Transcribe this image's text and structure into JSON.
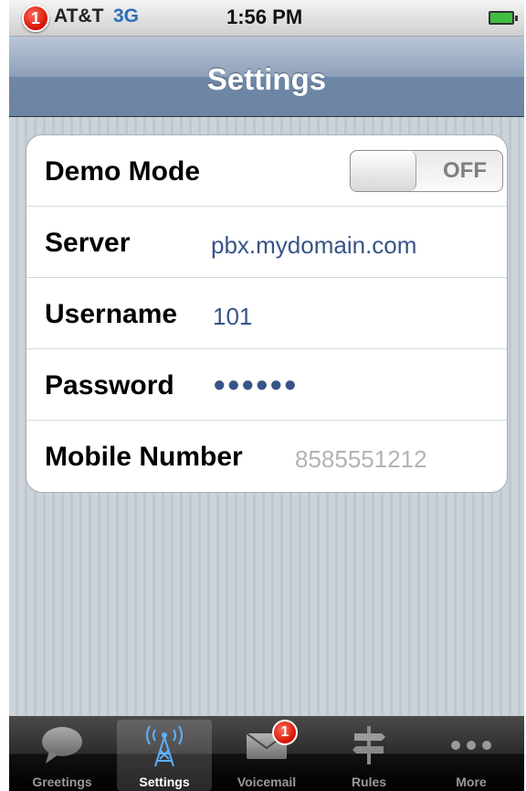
{
  "status_bar": {
    "badge_count": "1",
    "carrier": "AT&T",
    "network": "3G",
    "time": "1:56 PM",
    "battery_icon": "battery-charging-icon"
  },
  "nav_bar": {
    "title": "Settings"
  },
  "settings": {
    "demo_mode": {
      "label": "Demo Mode",
      "toggle_text": "OFF",
      "on": false
    },
    "server": {
      "label": "Server",
      "value": "pbx.mydomain.com"
    },
    "username": {
      "label": "Username",
      "value": "101"
    },
    "password": {
      "label": "Password",
      "value": "●●●●●●"
    },
    "mobile_number": {
      "label": "Mobile Number",
      "placeholder": "8585551212"
    }
  },
  "tab_bar": {
    "tabs": [
      {
        "label": "Greetings",
        "icon": "speech-bubble-icon",
        "selected": false
      },
      {
        "label": "Settings",
        "icon": "antenna-tower-icon",
        "selected": true
      },
      {
        "label": "Voicemail",
        "icon": "envelope-icon",
        "selected": false,
        "badge": "1"
      },
      {
        "label": "Rules",
        "icon": "signpost-icon",
        "selected": false
      },
      {
        "label": "More",
        "icon": "more-dots-icon",
        "selected": false
      }
    ]
  },
  "colors": {
    "nav_bar": "#7088a7",
    "value_text": "#385487",
    "badge": "#d41100",
    "network_text": "#2a6fb8"
  }
}
